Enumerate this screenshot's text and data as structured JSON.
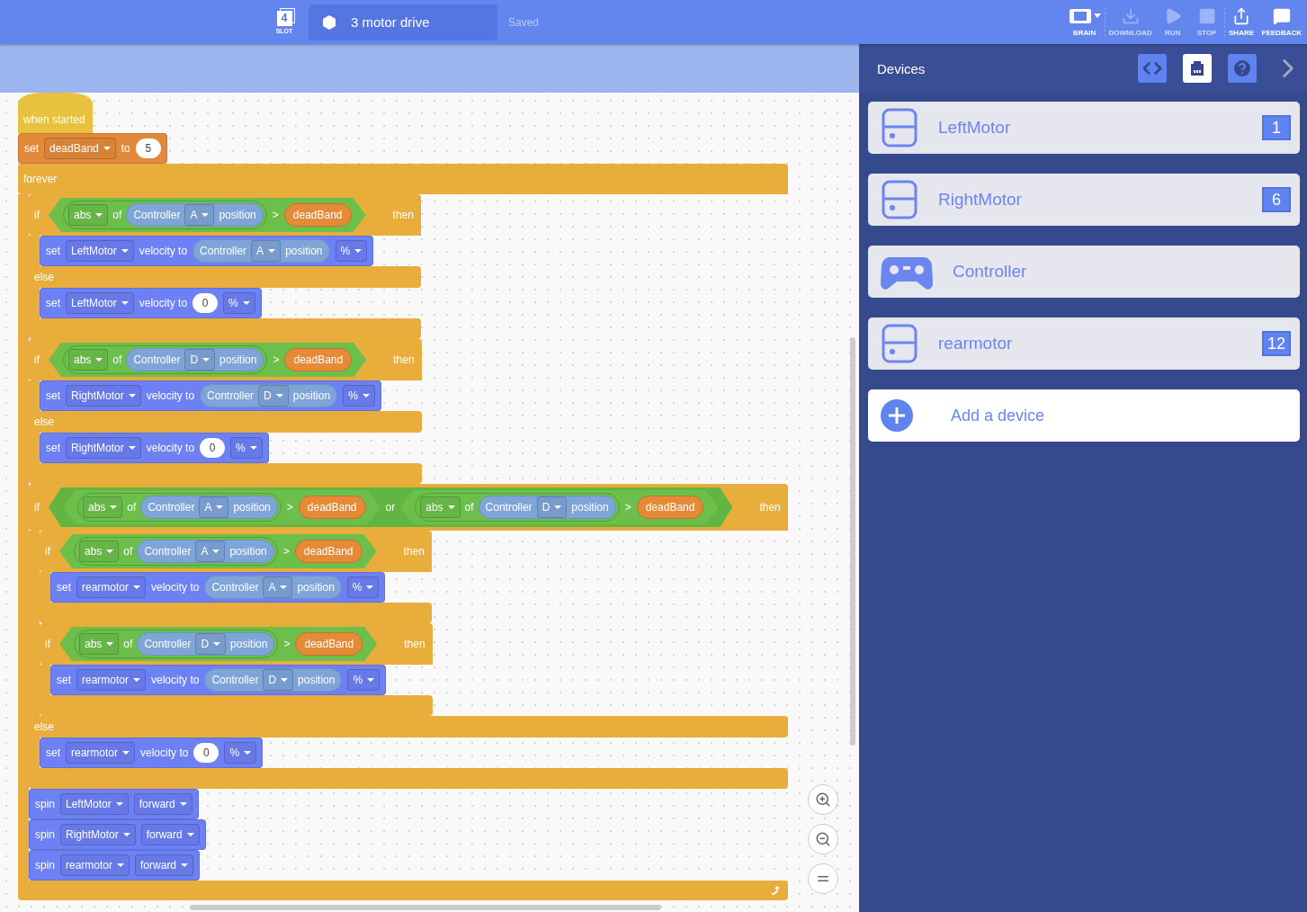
{
  "top_bar": {
    "slot": {
      "number": "4",
      "label": "SLOT"
    },
    "project_name": "3 motor drive",
    "save_status": "Saved",
    "tools": [
      {
        "kind": "brain",
        "label": "BRAIN",
        "disabled": false
      },
      {
        "kind": "download",
        "label": "DOWNLOAD",
        "disabled": true
      },
      {
        "kind": "run",
        "label": "RUN",
        "disabled": true
      },
      {
        "kind": "stop",
        "label": "STOP",
        "disabled": true
      },
      {
        "kind": "share",
        "label": "SHARE",
        "disabled": false
      },
      {
        "kind": "feedback",
        "label": "FEEDBACK",
        "disabled": false
      }
    ]
  },
  "script": [
    {
      "kind": "hat",
      "text": "when started"
    },
    {
      "kind": "variable",
      "parts": [
        {
          "kind": "text",
          "text": "set"
        },
        {
          "kind": "dropdown",
          "text": "deadBand"
        },
        {
          "kind": "text",
          "text": "to"
        },
        {
          "kind": "number",
          "text": "5"
        }
      ]
    },
    {
      "kind": "forever",
      "label": "forever",
      "body": [
        {
          "kind": "if",
          "label": "if",
          "then_label": "then",
          "condition": {
            "kind": "boolean",
            "parts": [
              {
                "kind": "round",
                "parts": [
                  {
                    "kind": "dropdown",
                    "text": "abs"
                  },
                  {
                    "kind": "text",
                    "text": "of"
                  },
                  {
                    "kind": "reporter",
                    "parts": [
                      {
                        "kind": "text",
                        "text": "Controller"
                      },
                      {
                        "kind": "dropdown",
                        "text": "A"
                      },
                      {
                        "kind": "text",
                        "text": "position"
                      }
                    ]
                  }
                ]
              },
              {
                "kind": "text",
                "text": ">"
              },
              {
                "kind": "variable",
                "text": "deadBand"
              }
            ]
          },
          "body": [
            {
              "kind": "motion",
              "parts": [
                {
                  "kind": "text",
                  "text": "set"
                },
                {
                  "kind": "dropdown",
                  "text": "LeftMotor"
                },
                {
                  "kind": "text",
                  "text": "velocity to"
                },
                {
                  "kind": "reporter",
                  "parts": [
                    {
                      "kind": "text",
                      "text": "Controller"
                    },
                    {
                      "kind": "dropdown",
                      "text": "A"
                    },
                    {
                      "kind": "text",
                      "text": "position"
                    }
                  ]
                },
                {
                  "kind": "dropdown",
                  "text": "%"
                }
              ]
            }
          ],
          "else_label": "else",
          "else_body": [
            {
              "kind": "motion",
              "parts": [
                {
                  "kind": "text",
                  "text": "set"
                },
                {
                  "kind": "dropdown",
                  "text": "LeftMotor"
                },
                {
                  "kind": "text",
                  "text": "velocity to"
                },
                {
                  "kind": "number",
                  "text": "0"
                },
                {
                  "kind": "dropdown",
                  "text": "%"
                }
              ]
            }
          ]
        },
        {
          "kind": "if",
          "label": "if",
          "then_label": "then",
          "condition": {
            "kind": "boolean",
            "parts": [
              {
                "kind": "round",
                "parts": [
                  {
                    "kind": "dropdown",
                    "text": "abs"
                  },
                  {
                    "kind": "text",
                    "text": "of"
                  },
                  {
                    "kind": "reporter",
                    "parts": [
                      {
                        "kind": "text",
                        "text": "Controller"
                      },
                      {
                        "kind": "dropdown",
                        "text": "D"
                      },
                      {
                        "kind": "text",
                        "text": "position"
                      }
                    ]
                  }
                ]
              },
              {
                "kind": "text",
                "text": ">"
              },
              {
                "kind": "variable",
                "text": "deadBand"
              }
            ]
          },
          "body": [
            {
              "kind": "motion",
              "parts": [
                {
                  "kind": "text",
                  "text": "set"
                },
                {
                  "kind": "dropdown",
                  "text": "RightMotor"
                },
                {
                  "kind": "text",
                  "text": "velocity to"
                },
                {
                  "kind": "reporter",
                  "parts": [
                    {
                      "kind": "text",
                      "text": "Controller"
                    },
                    {
                      "kind": "dropdown",
                      "text": "D"
                    },
                    {
                      "kind": "text",
                      "text": "position"
                    }
                  ]
                },
                {
                  "kind": "dropdown",
                  "text": "%"
                }
              ]
            }
          ],
          "else_label": "else",
          "else_body": [
            {
              "kind": "motion",
              "parts": [
                {
                  "kind": "text",
                  "text": "set"
                },
                {
                  "kind": "dropdown",
                  "text": "RightMotor"
                },
                {
                  "kind": "text",
                  "text": "velocity to"
                },
                {
                  "kind": "number",
                  "text": "0"
                },
                {
                  "kind": "dropdown",
                  "text": "%"
                }
              ]
            }
          ]
        },
        {
          "kind": "if",
          "label": "if",
          "then_label": "then",
          "condition": {
            "kind": "boolean",
            "parts": [
              {
                "kind": "boolean",
                "parts": [
                  {
                    "kind": "round",
                    "parts": [
                      {
                        "kind": "dropdown",
                        "text": "abs"
                      },
                      {
                        "kind": "text",
                        "text": "of"
                      },
                      {
                        "kind": "reporter",
                        "parts": [
                          {
                            "kind": "text",
                            "text": "Controller"
                          },
                          {
                            "kind": "dropdown",
                            "text": "A"
                          },
                          {
                            "kind": "text",
                            "text": "position"
                          }
                        ]
                      }
                    ]
                  },
                  {
                    "kind": "text",
                    "text": ">"
                  },
                  {
                    "kind": "variable",
                    "text": "deadBand"
                  }
                ]
              },
              {
                "kind": "text",
                "text": "or"
              },
              {
                "kind": "boolean",
                "parts": [
                  {
                    "kind": "round",
                    "parts": [
                      {
                        "kind": "dropdown",
                        "text": "abs"
                      },
                      {
                        "kind": "text",
                        "text": "of"
                      },
                      {
                        "kind": "reporter",
                        "parts": [
                          {
                            "kind": "text",
                            "text": "Controller"
                          },
                          {
                            "kind": "dropdown",
                            "text": "D"
                          },
                          {
                            "kind": "text",
                            "text": "position"
                          }
                        ]
                      }
                    ]
                  },
                  {
                    "kind": "text",
                    "text": ">"
                  },
                  {
                    "kind": "variable",
                    "text": "deadBand"
                  }
                ]
              }
            ]
          },
          "body": [
            {
              "kind": "if",
              "label": "if",
              "then_label": "then",
              "condition": {
                "kind": "boolean",
                "parts": [
                  {
                    "kind": "round",
                    "parts": [
                      {
                        "kind": "dropdown",
                        "text": "abs"
                      },
                      {
                        "kind": "text",
                        "text": "of"
                      },
                      {
                        "kind": "reporter",
                        "parts": [
                          {
                            "kind": "text",
                            "text": "Controller"
                          },
                          {
                            "kind": "dropdown",
                            "text": "A"
                          },
                          {
                            "kind": "text",
                            "text": "position"
                          }
                        ]
                      }
                    ]
                  },
                  {
                    "kind": "text",
                    "text": ">"
                  },
                  {
                    "kind": "variable",
                    "text": "deadBand"
                  }
                ]
              },
              "body": [
                {
                  "kind": "motion",
                  "parts": [
                    {
                      "kind": "text",
                      "text": "set"
                    },
                    {
                      "kind": "dropdown",
                      "text": "rearmotor"
                    },
                    {
                      "kind": "text",
                      "text": "velocity to"
                    },
                    {
                      "kind": "reporter",
                      "parts": [
                        {
                          "kind": "text",
                          "text": "Controller"
                        },
                        {
                          "kind": "dropdown",
                          "text": "A"
                        },
                        {
                          "kind": "text",
                          "text": "position"
                        }
                      ]
                    },
                    {
                      "kind": "dropdown",
                      "text": "%"
                    }
                  ]
                }
              ]
            },
            {
              "kind": "if",
              "label": "if",
              "then_label": "then",
              "condition": {
                "kind": "boolean",
                "parts": [
                  {
                    "kind": "round",
                    "parts": [
                      {
                        "kind": "dropdown",
                        "text": "abs"
                      },
                      {
                        "kind": "text",
                        "text": "of"
                      },
                      {
                        "kind": "reporter",
                        "parts": [
                          {
                            "kind": "text",
                            "text": "Controller"
                          },
                          {
                            "kind": "dropdown",
                            "text": "D"
                          },
                          {
                            "kind": "text",
                            "text": "position"
                          }
                        ]
                      }
                    ]
                  },
                  {
                    "kind": "text",
                    "text": ">"
                  },
                  {
                    "kind": "variable",
                    "text": "deadBand"
                  }
                ]
              },
              "body": [
                {
                  "kind": "motion",
                  "parts": [
                    {
                      "kind": "text",
                      "text": "set"
                    },
                    {
                      "kind": "dropdown",
                      "text": "rearmotor"
                    },
                    {
                      "kind": "text",
                      "text": "velocity to"
                    },
                    {
                      "kind": "reporter",
                      "parts": [
                        {
                          "kind": "text",
                          "text": "Controller"
                        },
                        {
                          "kind": "dropdown",
                          "text": "D"
                        },
                        {
                          "kind": "text",
                          "text": "position"
                        }
                      ]
                    },
                    {
                      "kind": "dropdown",
                      "text": "%"
                    }
                  ]
                }
              ]
            }
          ],
          "else_label": "else",
          "else_body": [
            {
              "kind": "motion",
              "parts": [
                {
                  "kind": "text",
                  "text": "set"
                },
                {
                  "kind": "dropdown",
                  "text": "rearmotor"
                },
                {
                  "kind": "text",
                  "text": "velocity to"
                },
                {
                  "kind": "number",
                  "text": "0"
                },
                {
                  "kind": "dropdown",
                  "text": "%"
                }
              ]
            }
          ]
        },
        {
          "kind": "motion",
          "parts": [
            {
              "kind": "text",
              "text": "spin"
            },
            {
              "kind": "dropdown",
              "text": "LeftMotor"
            },
            {
              "kind": "dropdown",
              "text": "forward"
            }
          ]
        },
        {
          "kind": "motion",
          "parts": [
            {
              "kind": "text",
              "text": "spin"
            },
            {
              "kind": "dropdown",
              "text": "RightMotor"
            },
            {
              "kind": "dropdown",
              "text": "forward"
            }
          ]
        },
        {
          "kind": "motion",
          "parts": [
            {
              "kind": "text",
              "text": "spin"
            },
            {
              "kind": "dropdown",
              "text": "rearmotor"
            },
            {
              "kind": "dropdown",
              "text": "forward"
            }
          ]
        }
      ]
    }
  ],
  "devices_panel": {
    "title": "Devices",
    "tabs": [
      {
        "kind": "code",
        "selected": false
      },
      {
        "kind": "devices",
        "selected": true
      },
      {
        "kind": "help",
        "selected": false
      }
    ],
    "devices": [
      {
        "kind": "motor",
        "name": "LeftMotor",
        "port": "1"
      },
      {
        "kind": "motor",
        "name": "RightMotor",
        "port": "6"
      },
      {
        "kind": "controller",
        "name": "Controller"
      },
      {
        "kind": "motor",
        "name": "rearmotor",
        "port": "12"
      }
    ],
    "add_device": {
      "label": "Add a device"
    }
  }
}
